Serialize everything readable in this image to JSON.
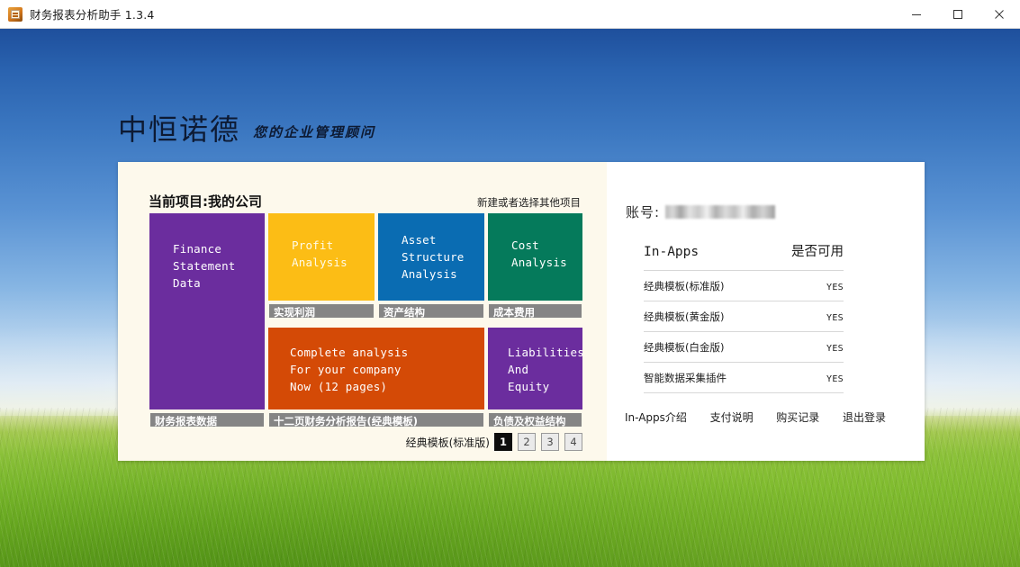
{
  "window": {
    "title": "财务报表分析助手 1.3.4",
    "icon": "app-icon",
    "minimize_label": "—",
    "maximize_label": "▢",
    "close_label": "✕"
  },
  "branding": {
    "name": "中恒诺德",
    "tagline": "您的企业管理顾问"
  },
  "left_panel": {
    "project_title": "当前项目:我的公司",
    "new_project_link": "新建或者选择其他项目",
    "tiles": [
      {
        "key": "finance",
        "lines": [
          "Finance",
          "Statement",
          "Data"
        ],
        "caption": "财务报表数据",
        "color": "#6b2d9e"
      },
      {
        "key": "profit",
        "lines": [
          "Profit",
          "Analysis"
        ],
        "caption": "实现利润",
        "color": "#fcbd15"
      },
      {
        "key": "asset",
        "lines": [
          "Asset",
          "Structure",
          "Analysis"
        ],
        "caption": "资产结构",
        "color": "#0a6cb2"
      },
      {
        "key": "cost",
        "lines": [
          "Cost",
          "Analysis"
        ],
        "caption": "成本费用",
        "color": "#057a5b"
      },
      {
        "key": "complete",
        "lines": [
          "Complete analysis",
          "For your company",
          "Now (12 pages)"
        ],
        "caption": "十二页财务分析报告(经典模板)",
        "color": "#d44a06"
      },
      {
        "key": "liabilities",
        "lines": [
          "Liabilities",
          "And",
          "Equity"
        ],
        "caption": "负债及权益结构",
        "color": "#6b2d9e"
      }
    ],
    "pager": {
      "label": "经典模板(标准版)",
      "pages": [
        "1",
        "2",
        "3",
        "4"
      ],
      "active": "1"
    }
  },
  "right_panel": {
    "account_label": "账号:",
    "account_value_masked": "",
    "table": {
      "header_name": "In-Apps",
      "header_value": "是否可用",
      "rows": [
        {
          "name": "经典模板(标准版)",
          "value": "YES"
        },
        {
          "name": "经典模板(黄金版)",
          "value": "YES"
        },
        {
          "name": "经典模板(白金版)",
          "value": "YES"
        },
        {
          "name": "智能数据采集插件",
          "value": "YES"
        }
      ]
    },
    "links": [
      "In-Apps介绍",
      "支付说明",
      "购买记录",
      "退出登录"
    ]
  }
}
